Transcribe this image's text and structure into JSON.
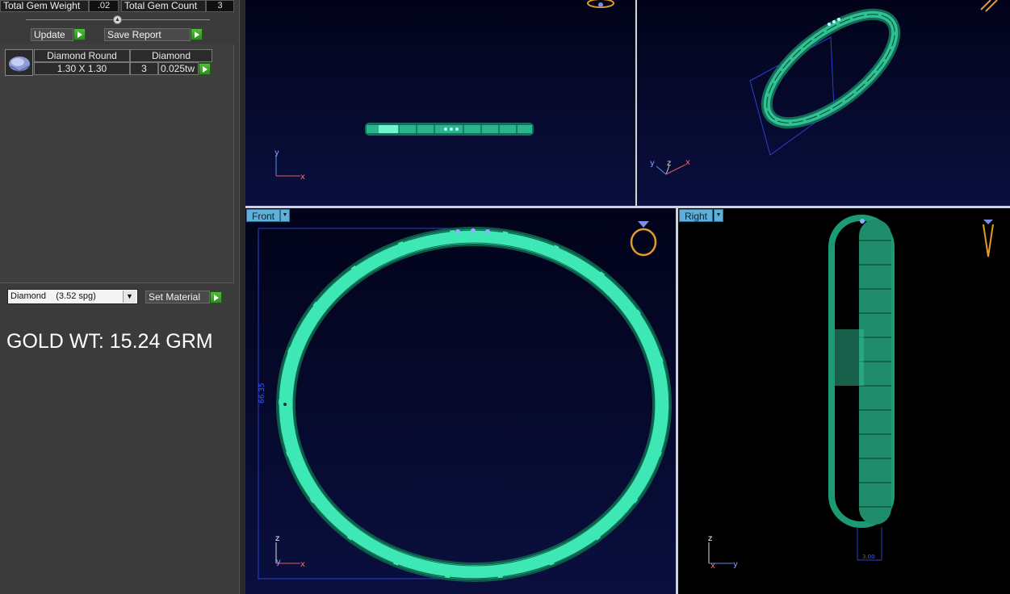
{
  "stats": {
    "total_gem_weight_label": "Total Gem Weight",
    "total_gem_weight_value": ".02",
    "total_gem_count_label": "Total Gem Count",
    "total_gem_count_value": "3"
  },
  "actions": {
    "update_label": "Update",
    "save_report_label": "Save Report"
  },
  "gem_table": {
    "rows": [
      {
        "shape": "Diamond Round",
        "material": "Diamond",
        "size": "1.30 X 1.30",
        "count": "3",
        "weight": "0.025tw"
      }
    ]
  },
  "material": {
    "selected": "Diamond    (3.52 spg)",
    "set_label": "Set Material"
  },
  "gold_weight": "GOLD WT: 15.24 GRM",
  "viewports": {
    "front": {
      "label": "Front",
      "dimension_text": "66.35"
    },
    "right": {
      "label": "Right",
      "dimension_text": "3.00"
    }
  },
  "axes": {
    "x": "x",
    "y": "y",
    "z": "z"
  },
  "colors": {
    "ring": "#3ee8b4",
    "ring_dark": "#1f9e74",
    "viewport_bg": "#05082a",
    "label_bg": "#5fb0d8",
    "go_button": "#3fa52e"
  },
  "icons": [
    "dropdown-arrow-icon",
    "play-arrow-icon",
    "diamond-thumbnail-icon",
    "ring-preview-icon",
    "axis-gizmo-icon"
  ]
}
